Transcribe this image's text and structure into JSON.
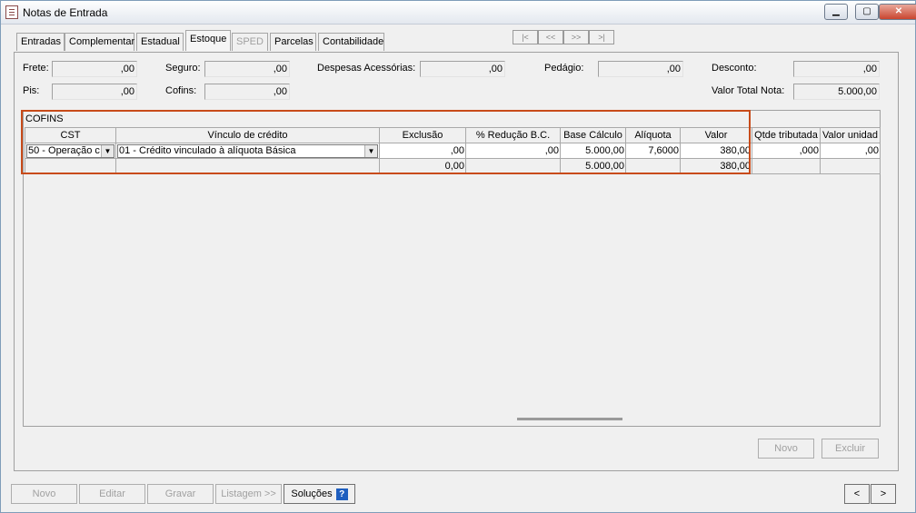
{
  "window": {
    "title": "Notas de Entrada",
    "controls": {
      "minimize": "▁",
      "maximize": "▢",
      "close": "✕"
    }
  },
  "tabs": [
    {
      "label": "Entradas"
    },
    {
      "label": "Complementar"
    },
    {
      "label": "Estadual"
    },
    {
      "label": "Estoque"
    },
    {
      "label": "SPED"
    },
    {
      "label": "Parcelas"
    },
    {
      "label": "Contabilidade"
    }
  ],
  "record_nav": {
    "first": "|<",
    "prev": "<<",
    "next": ">>",
    "last": ">|"
  },
  "fields": {
    "frete": {
      "label": "Frete:",
      "value": ",00"
    },
    "seguro": {
      "label": "Seguro:",
      "value": ",00"
    },
    "despesas": {
      "label": "Despesas Acessórias:",
      "value": ",00"
    },
    "pedagio": {
      "label": "Pedágio:",
      "value": ",00"
    },
    "desconto": {
      "label": "Desconto:",
      "value": ",00"
    },
    "pis": {
      "label": "Pis:",
      "value": ",00"
    },
    "cofins": {
      "label": "Cofins:",
      "value": ",00"
    },
    "valor_total": {
      "label": "Valor Total Nota:",
      "value": "5.000,00"
    }
  },
  "grid": {
    "title": "COFINS",
    "headers": [
      "CST",
      "Vínculo de crédito",
      "Exclusão",
      "% Redução B.C.",
      "Base Cálculo",
      "Alíquota",
      "Valor",
      "Qtde tributada",
      "Valor unidad"
    ],
    "row": {
      "cst": "50 - Operação c",
      "vinculo": "01 - Crédito vinculado à alíquota Básica",
      "exclusao": ",00",
      "reducao": ",00",
      "base": "5.000,00",
      "aliquota": "7,6000",
      "valor": "380,00",
      "qtde": ",000",
      "valor_unid": ",00"
    },
    "totals": {
      "exclusao": "0,00",
      "base": "5.000,00",
      "valor": "380,00"
    }
  },
  "panel_buttons": {
    "novo": "Novo",
    "excluir": "Excluir"
  },
  "bottom_buttons": {
    "novo": "Novo",
    "editar": "Editar",
    "gravar": "Gravar",
    "listagem": "Listagem >>",
    "solucoes": "Soluções",
    "help": "?"
  },
  "page_nav": {
    "prev": "<",
    "next": ">"
  }
}
